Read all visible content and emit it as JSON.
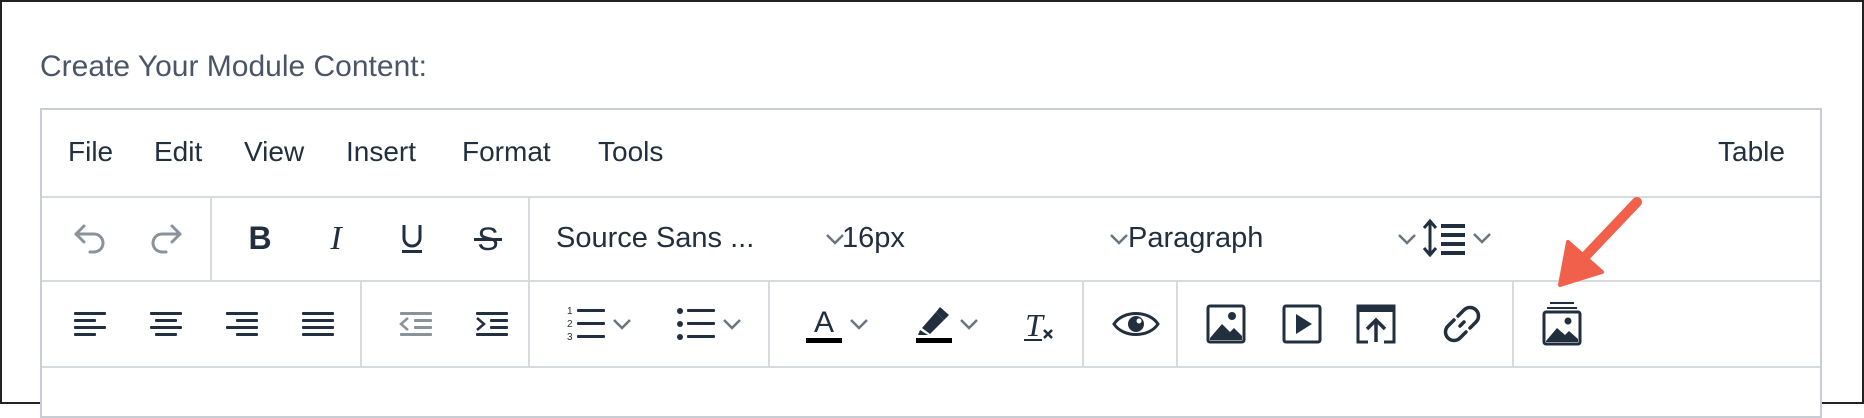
{
  "heading": "Create Your Module Content:",
  "menubar": {
    "items": [
      "File",
      "Edit",
      "View",
      "Insert",
      "Format",
      "Tools"
    ],
    "table_label": "Table"
  },
  "toolbar": {
    "font_family": "Source Sans ...",
    "font_size": "16px",
    "block_format": "Paragraph",
    "icons_row1": [
      "undo-icon",
      "redo-icon",
      "bold-icon",
      "italic-icon",
      "underline-icon",
      "strikethrough-icon",
      "line-height-icon"
    ],
    "icons_row2": [
      "align-left-icon",
      "align-center-icon",
      "align-right-icon",
      "align-justify-icon",
      "outdent-icon",
      "indent-icon",
      "numbered-list-icon",
      "bullet-list-icon",
      "text-color-icon",
      "highlight-color-icon",
      "clear-formatting-icon",
      "preview-icon",
      "image-icon",
      "media-icon",
      "upload-icon",
      "link-icon",
      "image-gallery-icon"
    ]
  },
  "colors": {
    "icon": "#222f3e",
    "disabled": "#8a939c",
    "border": "#c8cdd3",
    "arrow": "#f0604b"
  }
}
